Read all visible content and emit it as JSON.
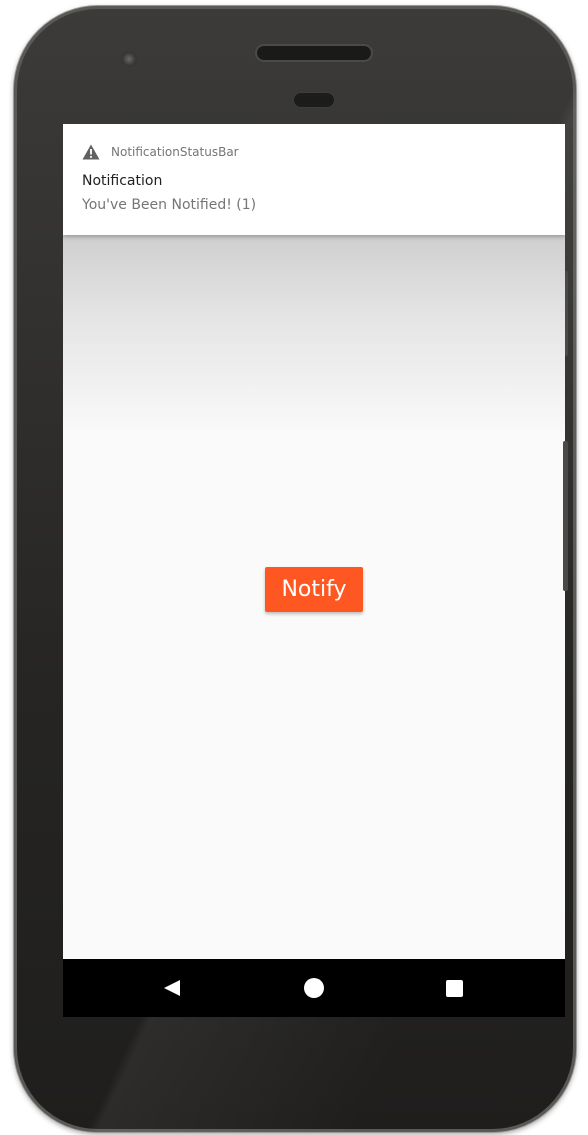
{
  "notification": {
    "app_name": "NotificationStatusBar",
    "title": "Notification",
    "text": "You've Been Notified! (1)",
    "icon": "warning-icon"
  },
  "main": {
    "notify_button_label": "Notify",
    "accent_color": "#ff5722"
  },
  "navbar": {
    "back_icon": "back-triangle-icon",
    "home_icon": "home-circle-icon",
    "recents_icon": "recents-square-icon"
  }
}
